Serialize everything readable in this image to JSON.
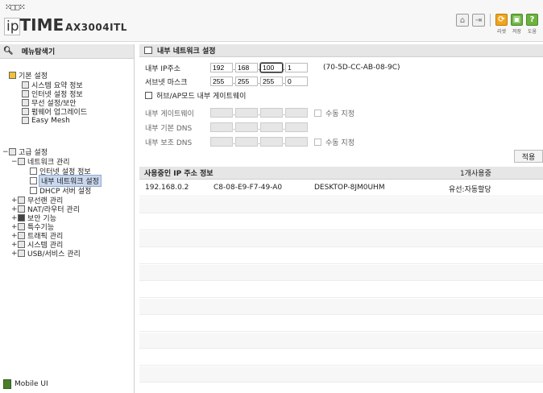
{
  "header": {
    "dots": "⁙□□⁙",
    "logo_ip": "ip",
    "logo_time": "TIME",
    "logo_model": "AX3004ITL",
    "icons": [
      "home-icon",
      "logout-icon"
    ],
    "buttons": [
      {
        "label": "리셋",
        "color": "#f0a51c"
      },
      {
        "label": "저장",
        "color": "#6db33f"
      },
      {
        "label": "도움",
        "color": "#6db33f"
      }
    ]
  },
  "sidebar": {
    "title": "메뉴탐색기",
    "basic": {
      "label": "기본 설정",
      "items": [
        "시스템 요약 정보",
        "인터넷 설정 정보",
        "무선 설정/보안",
        "펌웨어 업그레이드",
        "Easy Mesh"
      ]
    },
    "advanced": {
      "label": "고급 설정",
      "network": {
        "label": "네트워크 관리",
        "items": [
          "인터넷 설정 정보",
          "내부 네트워크 설정",
          "DHCP 서버 설정"
        ]
      },
      "others": [
        "무선랜 관리",
        "NAT/라우터 관리",
        "보안 기능",
        "특수기능",
        "트래픽 관리",
        "시스템 관리",
        "USB/서비스 관리"
      ]
    },
    "mobile_ui": "Mobile UI"
  },
  "main": {
    "section_title": "내부 네트워크 설정",
    "ip_label": "내부 IP주소",
    "ip": [
      "192",
      "168",
      "100",
      "1"
    ],
    "mac": "(70-5D-CC-AB-08-9C)",
    "mask_label": "서브넷 마스크",
    "mask": [
      "255",
      "255",
      "255",
      "0"
    ],
    "hub_ap_label": "허브/AP모드 내부 게이트웨이",
    "gateway_label": "내부 게이트웨이",
    "manual_label": "수동 지정",
    "dns1_label": "내부 기본 DNS",
    "dns2_label": "내부 보조 DNS",
    "apply_label": "적용",
    "table_title": "사용중인 IP 주소 정보",
    "table_count": "1개사용중",
    "rows": [
      {
        "ip": "192.168.0.2",
        "mac": "C8-08-E9-F7-49-A0",
        "name": "DESKTOP-8JM0UHM",
        "type": "유선:자동할당"
      }
    ]
  }
}
